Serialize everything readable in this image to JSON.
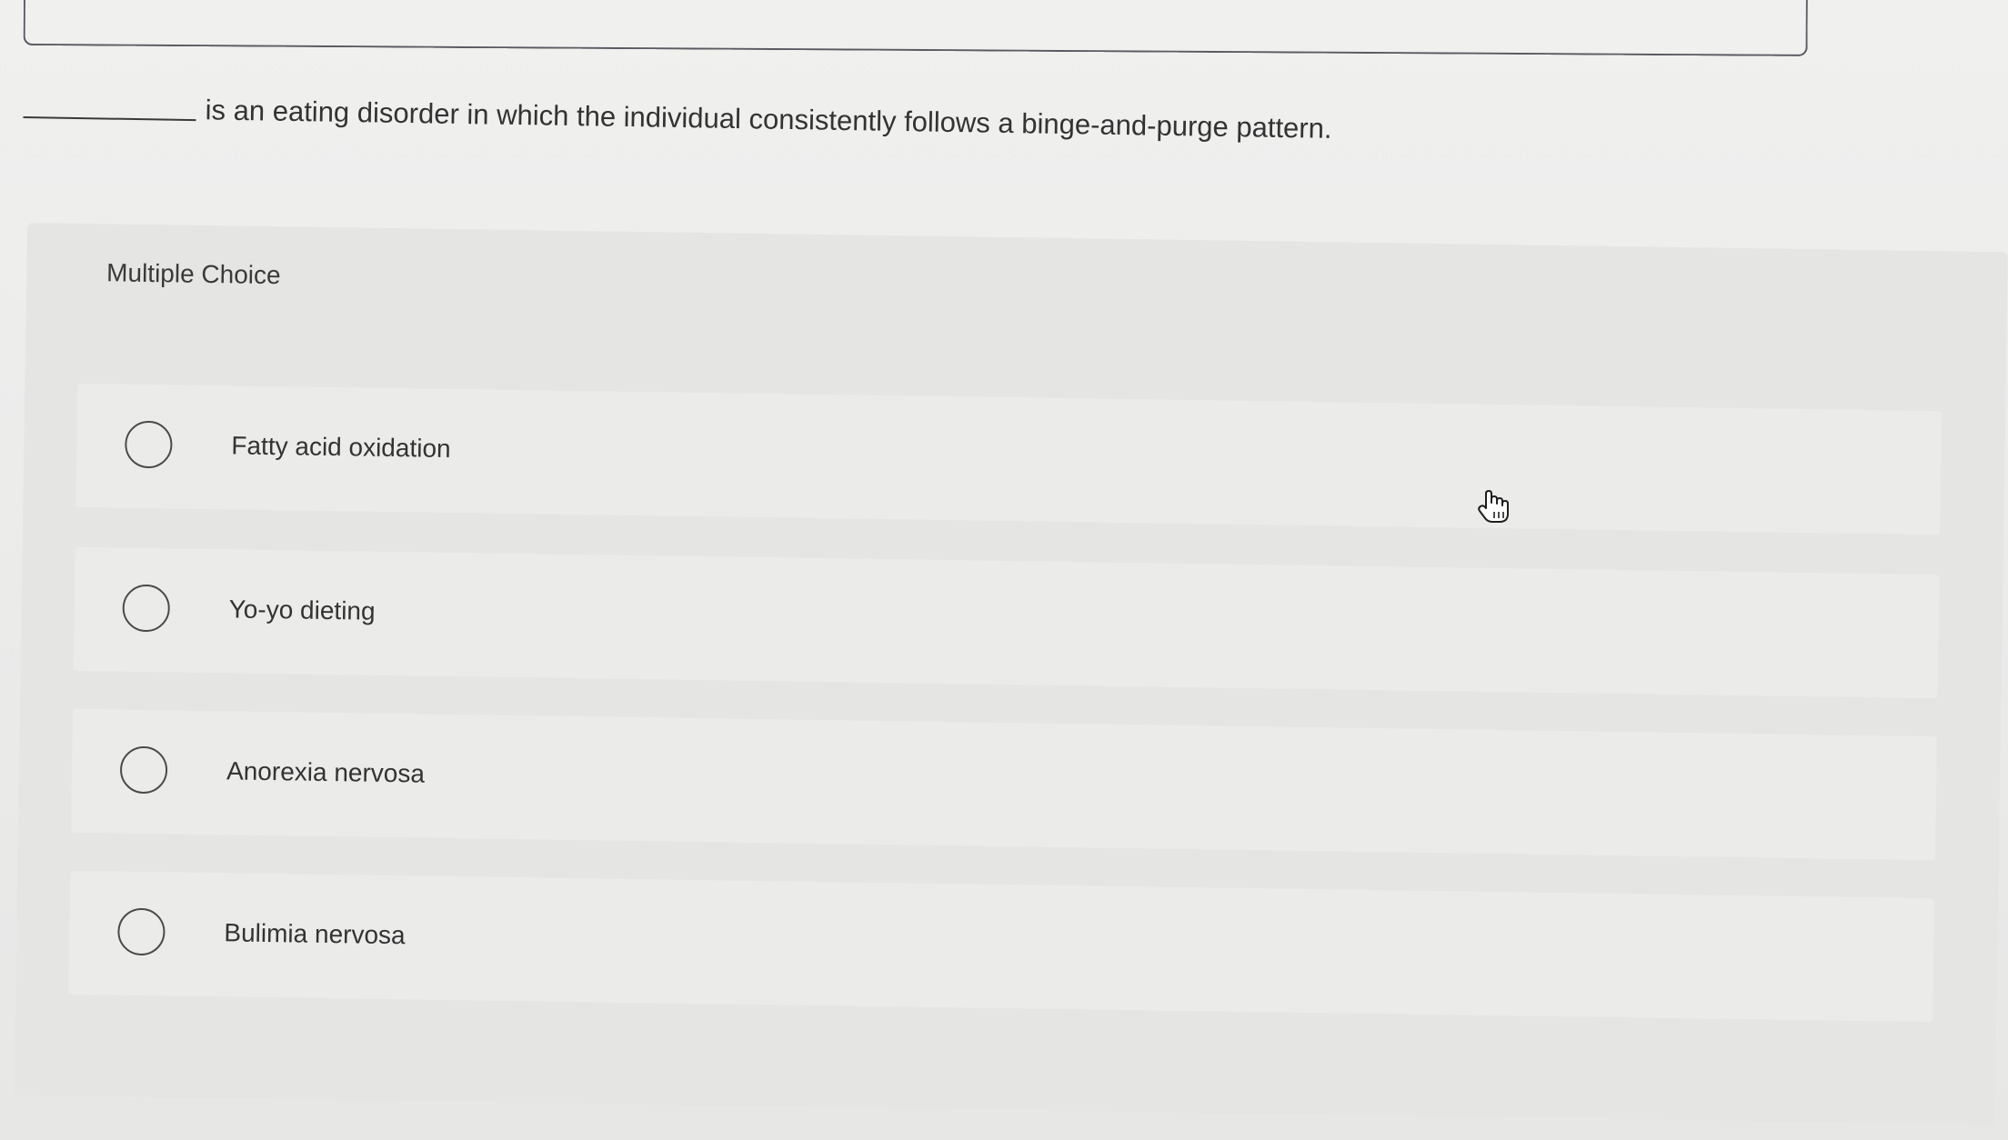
{
  "question": {
    "text": "is an eating disorder in which the individual consistently follows a binge-and-purge pattern."
  },
  "choices": {
    "heading": "Multiple Choice",
    "options": [
      {
        "label": "Fatty acid oxidation"
      },
      {
        "label": "Yo-yo dieting"
      },
      {
        "label": "Anorexia nervosa"
      },
      {
        "label": "Bulimia nervosa"
      }
    ]
  },
  "cursor": {
    "icon": "hand-pointer-icon"
  },
  "colors": {
    "background": "#eeeeed",
    "panel": "#e5e5e4",
    "option_row": "#ebebea",
    "text": "#333333",
    "radio_border": "#4a4a4a"
  }
}
